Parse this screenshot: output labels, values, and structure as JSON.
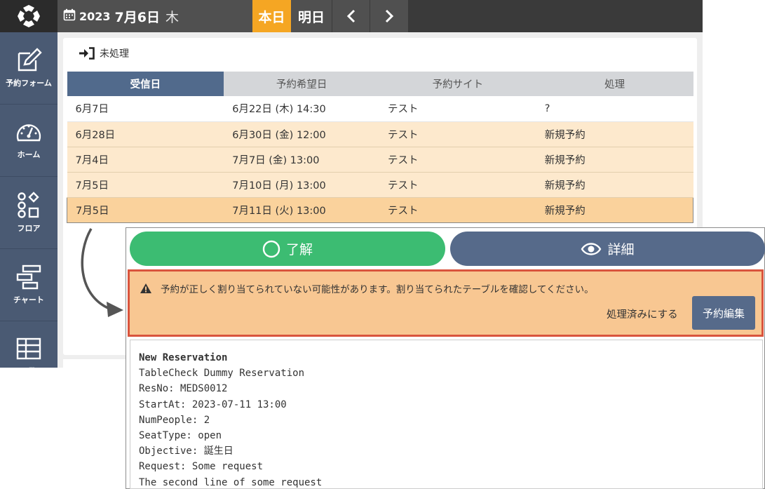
{
  "header": {
    "year": "2023",
    "date": "7月6日",
    "weekday": "木",
    "today_label": "本日",
    "tomorrow_label": "明日"
  },
  "sidebar": {
    "items": [
      {
        "label": "予約フォーム",
        "icon": "edit-form-icon"
      },
      {
        "label": "ホーム",
        "icon": "dashboard-gauge-icon"
      },
      {
        "label": "フロア",
        "icon": "floor-shapes-icon"
      },
      {
        "label": "チャート",
        "icon": "chart-bars-icon"
      },
      {
        "label": "一覧",
        "icon": "table-grid-icon"
      }
    ]
  },
  "section": {
    "title": "未処理",
    "icon": "sign-in-icon"
  },
  "table": {
    "columns": [
      "受信日",
      "予約希望日",
      "予約サイト",
      "処理"
    ],
    "rows": [
      {
        "received": "6月7日",
        "requested": "6月22日 (木) 14:30",
        "site": "テスト",
        "status": "?"
      },
      {
        "received": "6月28日",
        "requested": "6月30日 (金) 12:00",
        "site": "テスト",
        "status": "新規予約"
      },
      {
        "received": "7月4日",
        "requested": "7月7日 (金) 13:00",
        "site": "テスト",
        "status": "新規予約"
      },
      {
        "received": "7月5日",
        "requested": "7月10日 (月) 13:00",
        "site": "テスト",
        "status": "新規予約"
      },
      {
        "received": "7月5日",
        "requested": "7月11日 (火) 13:00",
        "site": "テスト",
        "status": "新規予約"
      }
    ]
  },
  "popup": {
    "ok_label": "了解",
    "detail_label": "詳細",
    "warning_text": "予約が正しく割り当てられていない可能性があります。割り当てられたテーブルを確認してください。",
    "processed_label": "処理済みにする",
    "edit_label": "予約編集",
    "mail_lines": [
      "New Reservation",
      "TableCheck Dummy Reservation",
      "ResNo: MEDS0012",
      "StartAt: 2023-07-11 13:00",
      "NumPeople: 2",
      "SeatType: open",
      "Objective: 誕生日",
      "Request: Some request",
      "The second line of some request"
    ]
  },
  "colors": {
    "accent_today": "#f5a623",
    "sidebar": "#4a5a73",
    "ok_green": "#3cbc72",
    "warning_border": "#d9543d"
  }
}
